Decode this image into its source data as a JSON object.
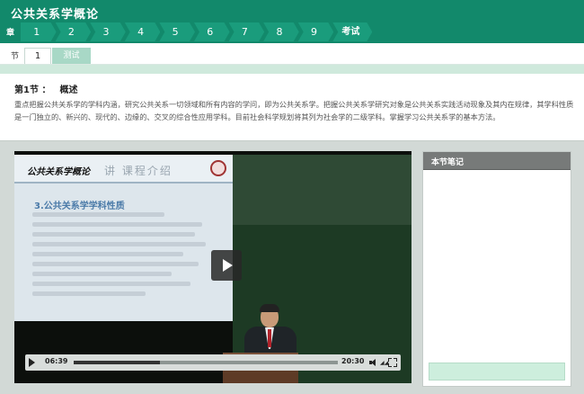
{
  "course": {
    "title": "公共关系学概论"
  },
  "chapters": {
    "label": "章",
    "items": [
      "1",
      "2",
      "3",
      "4",
      "5",
      "6",
      "7",
      "8",
      "9"
    ],
    "exam_label": "考试"
  },
  "section": {
    "label": "节",
    "current": "1",
    "test_label": "测试"
  },
  "intro": {
    "heading_prefix": "第1节 ：",
    "heading_name": "概述",
    "text": "重点把握公共关系学的学科内涵，研究公共关系一切领域和所有内容的学问，即为公共关系学。把握公共关系学研究对象是公共关系实践活动现象及其内在规律，其学科性质是一门独立的、新兴的、现代的、边缘的、交叉的综合性应用学科。目前社会科学规划将其列为社会学的二级学科。掌握学习公共关系学的基本方法。"
  },
  "video": {
    "slide_title": "公共关系学概论",
    "slide_header": "讲  课程介绍",
    "slide_point": "3.公共关系学学科性质",
    "current_time": "06:39",
    "total_time": "20:30",
    "progress_fraction": 0.325,
    "volume_bars": "◢◢"
  },
  "notes": {
    "title": "本节笔记"
  }
}
